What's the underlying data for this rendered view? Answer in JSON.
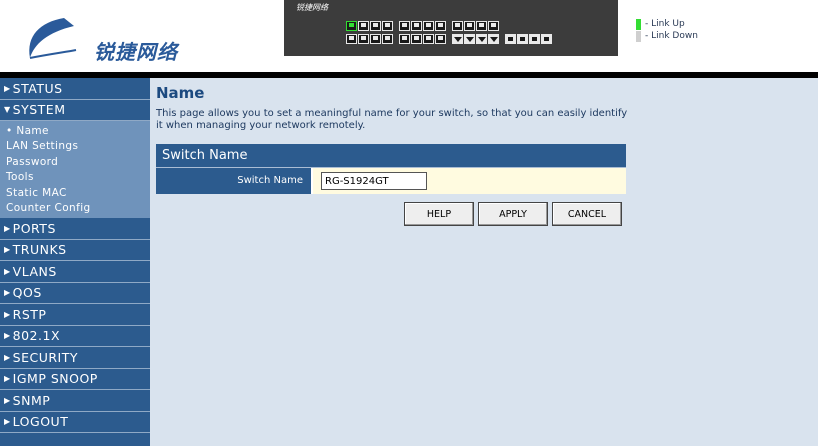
{
  "header": {
    "logo_text": "锐捷网络",
    "device_brand": "锐捷网络",
    "legend": {
      "link_up": "- Link Up",
      "link_down": "- Link Down",
      "link_up_color": "#33dd33",
      "link_down_color": "#cfcfcf"
    }
  },
  "sidebar": {
    "items": [
      {
        "label": "STATUS",
        "expanded": false
      },
      {
        "label": "SYSTEM",
        "expanded": true
      },
      {
        "label": "PORTS",
        "expanded": false
      },
      {
        "label": "TRUNKS",
        "expanded": false
      },
      {
        "label": "VLANS",
        "expanded": false
      },
      {
        "label": "QOS",
        "expanded": false
      },
      {
        "label": "RSTP",
        "expanded": false
      },
      {
        "label": "802.1X",
        "expanded": false
      },
      {
        "label": "SECURITY",
        "expanded": false
      },
      {
        "label": "IGMP SNOOP",
        "expanded": false
      },
      {
        "label": "SNMP",
        "expanded": false
      },
      {
        "label": "LOGOUT",
        "expanded": false
      }
    ],
    "system_subitems": [
      {
        "label": "• Name",
        "active": true
      },
      {
        "label": "LAN Settings",
        "active": false
      },
      {
        "label": "Password",
        "active": false
      },
      {
        "label": "Tools",
        "active": false
      },
      {
        "label": "Static MAC",
        "active": false
      },
      {
        "label": "Counter Config",
        "active": false
      }
    ]
  },
  "main": {
    "title": "Name",
    "description": "This page allows you to set a meaningful name for your switch, so that you can easily identify it when managing your network remotely.",
    "section_title": "Switch Name",
    "field_label": "Switch Name",
    "field_value": "RG-S1924GT",
    "buttons": {
      "help": "HELP",
      "apply": "APPLY",
      "cancel": "CANCEL"
    }
  },
  "colors": {
    "sidebar_bg": "#2c5b8e",
    "subpanel_bg": "#6f93bb",
    "content_bg": "#d9e3ee",
    "title_color": "#1c4a80",
    "input_row_bg": "#fffbe0"
  }
}
